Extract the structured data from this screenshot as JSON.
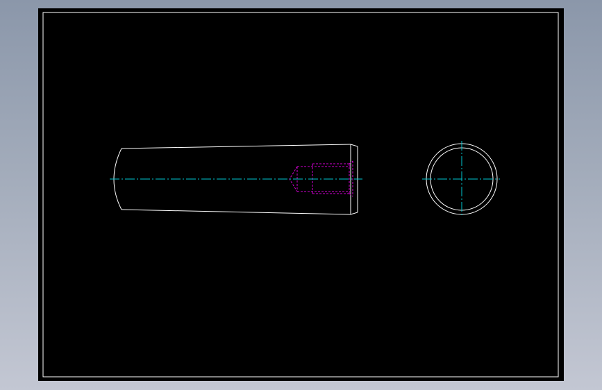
{
  "viewport": {
    "background_color": "#000000",
    "desktop_gradient": [
      "#8b97aa",
      "#c3c7d3"
    ]
  },
  "colors": {
    "outline": "#ffffff",
    "centerline": "#00c8d2",
    "hidden_line": "#d000d0"
  },
  "drawing": {
    "views": [
      {
        "name": "side-view",
        "features": [
          "tapered-pin-body",
          "hidden-threaded-hole",
          "centerline"
        ]
      },
      {
        "name": "end-view",
        "features": [
          "outer-circle",
          "inner-circle",
          "crosshair-centerlines"
        ]
      }
    ]
  }
}
